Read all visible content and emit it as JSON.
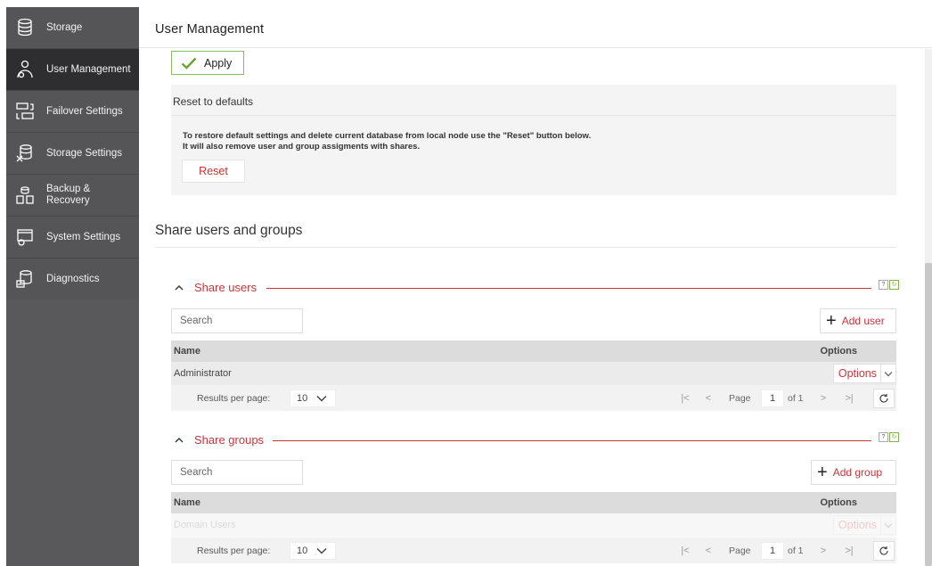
{
  "sidebar": {
    "items": [
      {
        "label": "Storage",
        "icon": "storage-icon"
      },
      {
        "label": "User Management",
        "icon": "user-management-icon"
      },
      {
        "label": "Failover Settings",
        "icon": "failover-icon"
      },
      {
        "label": "Storage Settings",
        "icon": "storage-settings-icon"
      },
      {
        "label": "Backup & Recovery",
        "icon": "backup-icon"
      },
      {
        "label": "System Settings",
        "icon": "system-settings-icon"
      },
      {
        "label": "Diagnostics",
        "icon": "diagnostics-icon"
      }
    ]
  },
  "header": {
    "title": "User Management"
  },
  "apply": {
    "label": "Apply"
  },
  "reset_section": {
    "title": "Reset to defaults",
    "desc_line1": "To restore default settings and delete current database from local node use the \"Reset\" button below.",
    "desc_line2": "It will also remove user and group assigments with shares.",
    "button": "Reset"
  },
  "share": {
    "heading": "Share users and groups",
    "users": {
      "title": "Share users",
      "search_placeholder": "Search",
      "add_label": "Add user",
      "columns": {
        "name": "Name",
        "options": "Options"
      },
      "rows": [
        {
          "name": "Administrator",
          "options": "Options"
        }
      ],
      "pager": {
        "rpp_label": "Results per page:",
        "rpp_value": "10",
        "page_label": "Page",
        "page": "1",
        "of": "of 1"
      }
    },
    "groups": {
      "title": "Share groups",
      "search_placeholder": "Search",
      "add_label": "Add group",
      "columns": {
        "name": "Name",
        "options": "Options"
      },
      "rows": [
        {
          "name": "Domain Users",
          "options": "Options"
        }
      ],
      "pager": {
        "rpp_label": "Results per page:",
        "rpp_value": "10",
        "page_label": "Page",
        "page": "1",
        "of": "of 1"
      }
    }
  },
  "colors": {
    "accent": "#c8343a",
    "apply_border": "#8bbd5b",
    "sidebar": "#555558",
    "sidebar_active": "#2e2e30"
  }
}
